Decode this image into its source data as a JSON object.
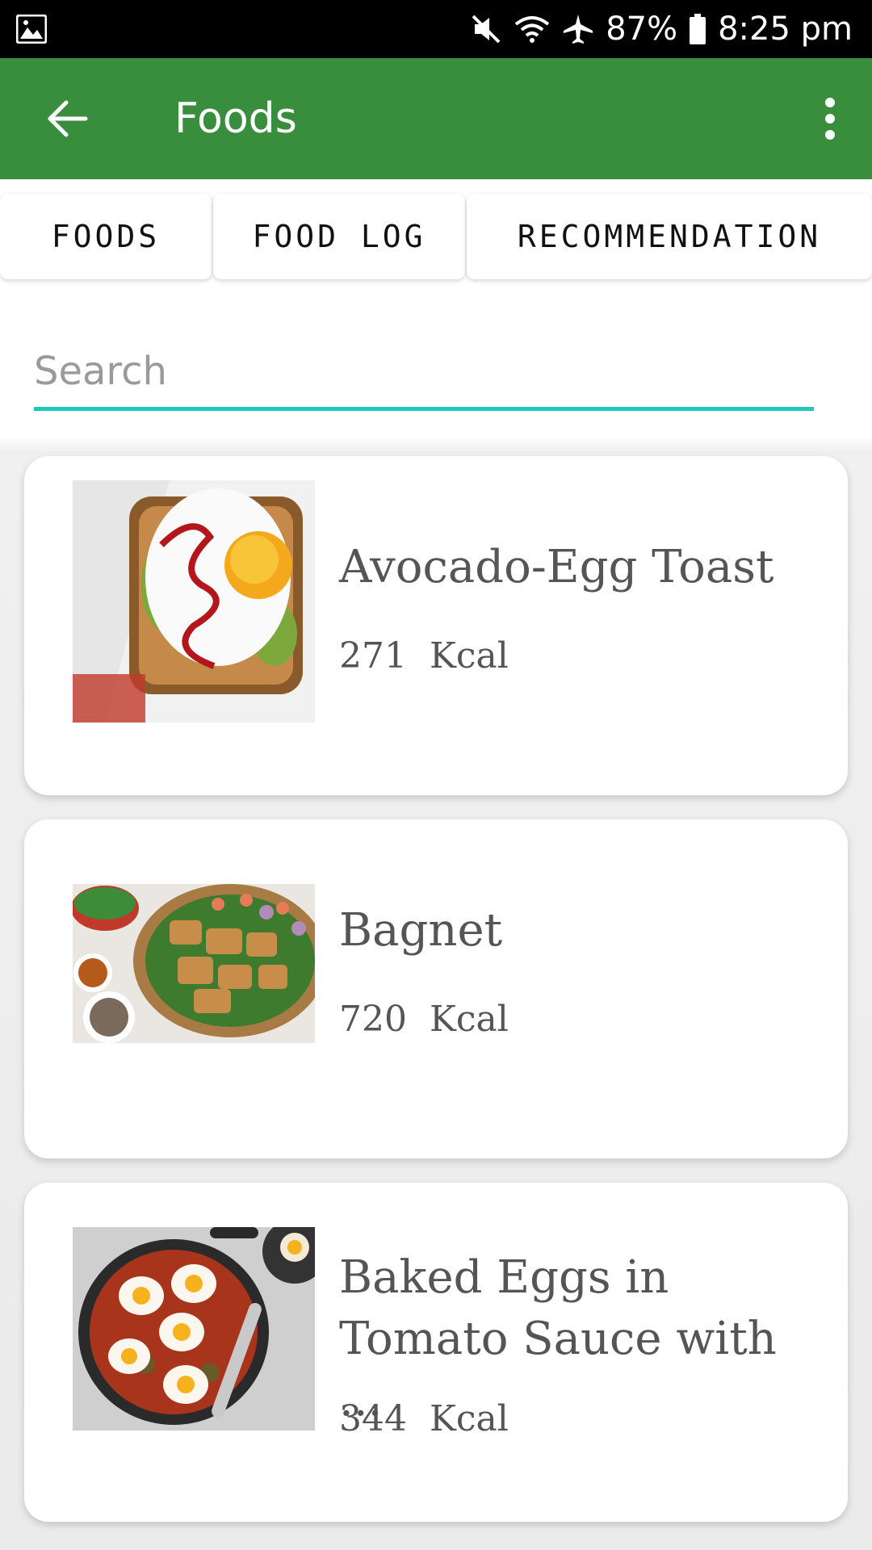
{
  "status_bar": {
    "battery": "87%",
    "time": "8:25 pm",
    "icons": [
      "image-icon",
      "mute-icon",
      "wifi-icon",
      "airplane-icon",
      "battery-icon"
    ]
  },
  "app_bar": {
    "title": "Foods",
    "color": "#388e3c",
    "icons": [
      "back-arrow-icon",
      "more-vert-icon"
    ]
  },
  "tabs": [
    {
      "label": "FOODS"
    },
    {
      "label": "FOOD LOG"
    },
    {
      "label": "RECOMMENDATION"
    }
  ],
  "search": {
    "placeholder": "Search",
    "value": "",
    "accent": "#1ec8b8"
  },
  "foods": [
    {
      "name": "Avocado-Egg Toast",
      "kcal": "271",
      "unit": "Kcal"
    },
    {
      "name": "Bagnet",
      "kcal": "720",
      "unit": "Kcal"
    },
    {
      "name": "Baked Eggs in Tomato Sauce with ...",
      "kcal": "344",
      "unit": "Kcal"
    }
  ]
}
